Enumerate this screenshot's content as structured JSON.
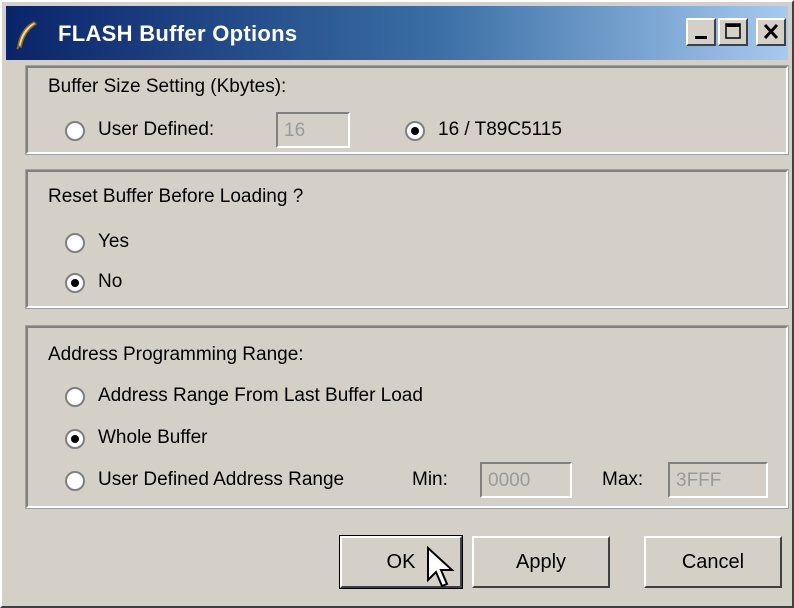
{
  "window": {
    "title": "FLASH Buffer Options",
    "icon": "feather-icon",
    "controls": [
      "minimize-icon",
      "maximize-icon",
      "close-icon"
    ]
  },
  "buffer_size": {
    "title": "Buffer Size Setting (Kbytes):",
    "user_defined_label": "User Defined:",
    "user_defined_value": "16",
    "preset_label": "16 / T89C5115",
    "selected": "preset"
  },
  "reset_buffer": {
    "title": "Reset Buffer Before Loading ?",
    "yes_label": "Yes",
    "no_label": "No",
    "selected": "no"
  },
  "address_range": {
    "title": "Address Programming Range:",
    "last_load_label": "Address Range From Last Buffer Load",
    "whole_label": "Whole Buffer",
    "user_range_label": "User Defined Address Range",
    "min_label": "Min:",
    "min_value": "0000",
    "max_label": "Max:",
    "max_value": "3FFF",
    "selected": "whole"
  },
  "buttons": {
    "ok": "OK",
    "apply": "Apply",
    "cancel": "Cancel"
  }
}
